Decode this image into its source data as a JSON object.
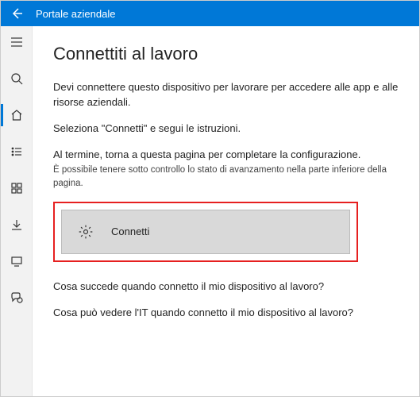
{
  "titlebar": {
    "title": "Portale aziendale"
  },
  "sidebar": {
    "items": [
      {
        "name": "hamburger-icon"
      },
      {
        "name": "search-icon"
      },
      {
        "name": "home-icon",
        "active": true
      },
      {
        "name": "list-icon"
      },
      {
        "name": "apps-icon"
      },
      {
        "name": "download-icon"
      },
      {
        "name": "devices-icon"
      },
      {
        "name": "support-icon"
      }
    ]
  },
  "main": {
    "heading": "Connettiti al lavoro",
    "p1": "Devi connettere questo dispositivo per lavorare per accedere alle app e alle risorse aziendali.",
    "p2": "Seleziona \"Connetti\" e segui le istruzioni.",
    "p3": "Al termine, torna a questa pagina per completare la configurazione.",
    "p3_sub": "È possibile tenere sotto controllo lo stato di avanzamento nella parte inferiore della pagina.",
    "connect_label": "Connetti",
    "q1": "Cosa succede quando connetto il mio dispositivo al lavoro?",
    "q2": "Cosa può vedere l'IT quando connetto il mio dispositivo al lavoro?"
  }
}
